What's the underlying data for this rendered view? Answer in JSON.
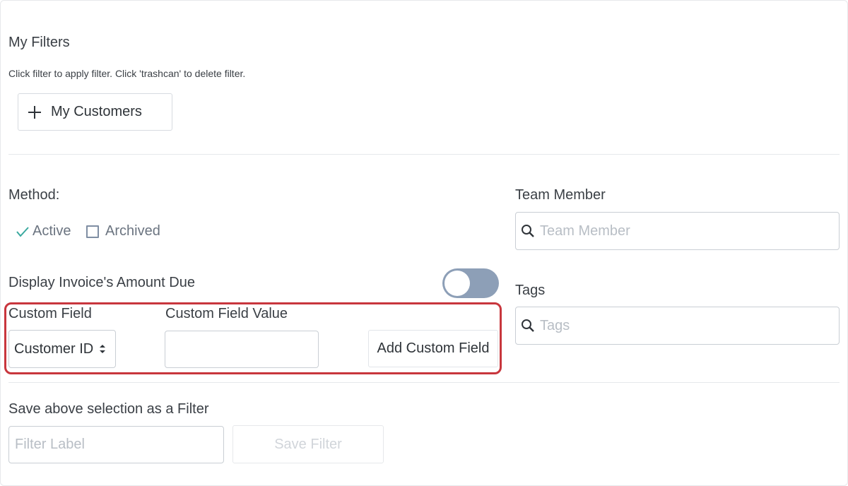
{
  "filters": {
    "heading": "My Filters",
    "hint": "Click filter to apply filter. Click 'trashcan' to delete filter.",
    "saved": [
      {
        "label": "My Customers",
        "icon": "plus-icon"
      }
    ]
  },
  "method": {
    "label": "Method:",
    "options": [
      {
        "label": "Active",
        "checked": true,
        "icon": "check-icon"
      },
      {
        "label": "Archived",
        "checked": false,
        "icon": "checkbox-icon"
      }
    ]
  },
  "amount_due": {
    "label": "Display Invoice's Amount Due",
    "enabled": false
  },
  "custom_field": {
    "field_label": "Custom Field",
    "selected": "Customer ID",
    "value_label": "Custom Field Value",
    "value": "",
    "add_button": "Add Custom Field"
  },
  "team_member": {
    "label": "Team Member",
    "placeholder": "Team Member",
    "icon": "search-icon"
  },
  "tags": {
    "label": "Tags",
    "placeholder": "Tags",
    "icon": "search-icon"
  },
  "save_filter": {
    "label": "Save above selection as a Filter",
    "placeholder": "Filter Label",
    "button": "Save Filter"
  },
  "colors": {
    "accent_check": "#3aa99f",
    "toggle_off": "#8d9fb7",
    "highlight": "#c8363d",
    "text": "#3a3f45",
    "placeholder": "#b8bec5"
  }
}
